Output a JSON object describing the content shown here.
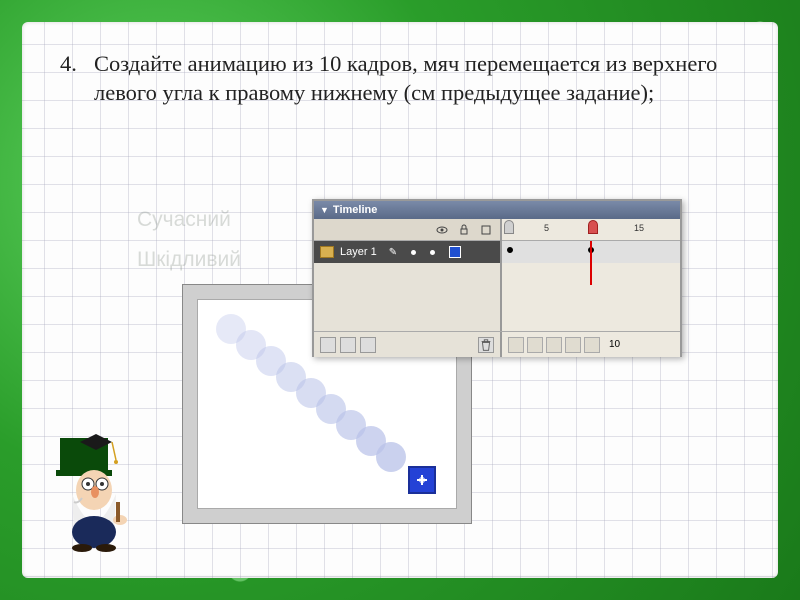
{
  "task": {
    "number": "4.",
    "text": "Создайте анимацию из 10 кадров, мяч перемещается из верхнего левого угла к правому нижнему (см предыдущее задание);"
  },
  "faded_background_words": [
    "Сучасний",
    "Шкідливий",
    "м"
  ],
  "timeline": {
    "title": "Timeline",
    "layer_name": "Layer 1",
    "ruler_marks": {
      "mark5": "5",
      "mark15": "15"
    },
    "current_frame": "10",
    "keyframes": [
      1,
      10
    ]
  },
  "icons": {
    "eye": "eye-icon",
    "lock": "lock-icon",
    "outline": "outline-icon",
    "trash": "trash-icon"
  }
}
